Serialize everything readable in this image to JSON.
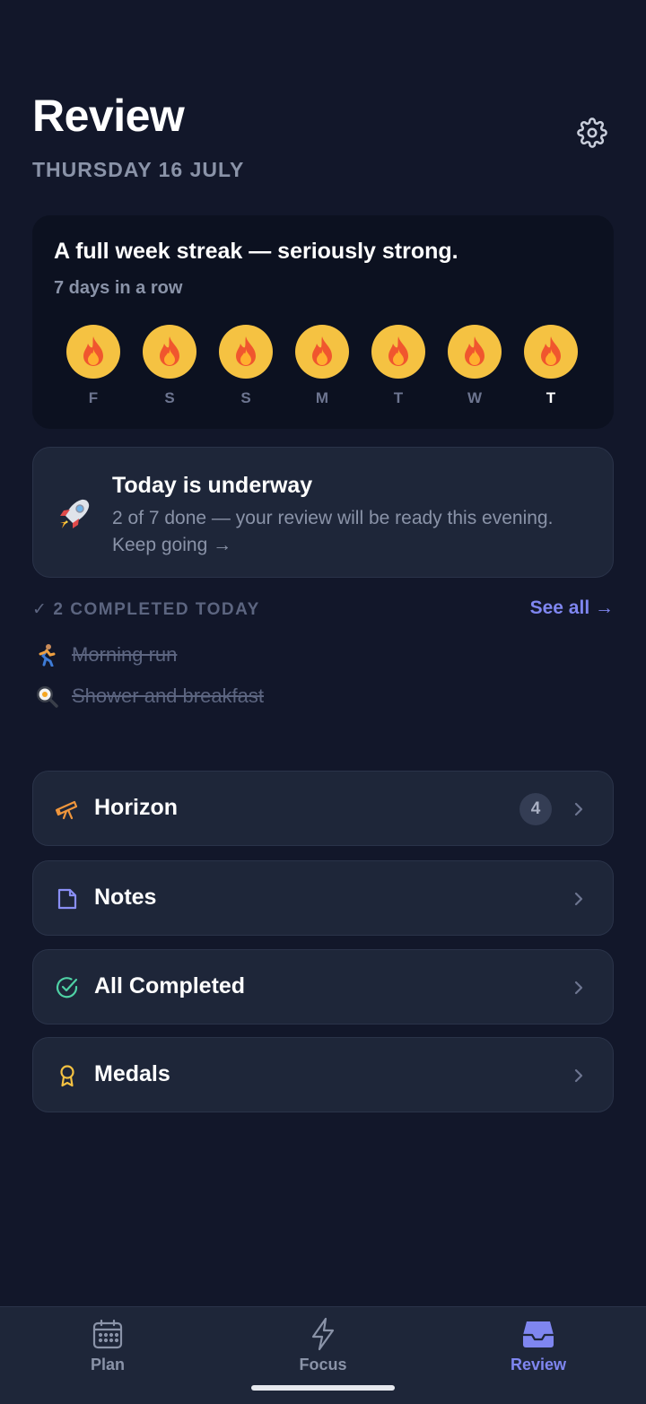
{
  "header": {
    "title": "Review",
    "date": "THURSDAY 16 JULY"
  },
  "streak": {
    "title": "A full week streak — seriously strong.",
    "subtitle": "7 days in a row",
    "days": [
      "F",
      "S",
      "S",
      "M",
      "T",
      "W",
      "T"
    ],
    "today_index": 6,
    "flame_color": "#f5c242"
  },
  "underway": {
    "title": "Today is underway",
    "body": "2 of 7 done — your review will be ready this evening. Keep going →"
  },
  "completed_today": {
    "label": "2 COMPLETED TODAY",
    "see_all": "See all →",
    "items": [
      {
        "icon": "runner-icon",
        "text": "Morning run"
      },
      {
        "icon": "fried-egg-icon",
        "text": "Shower and breakfast"
      }
    ]
  },
  "menu": [
    {
      "icon": "telescope-icon",
      "label": "Horizon",
      "badge": "4"
    },
    {
      "icon": "note-icon",
      "label": "Notes"
    },
    {
      "icon": "check-circle-icon",
      "label": "All Completed"
    },
    {
      "icon": "medal-icon",
      "label": "Medals"
    }
  ],
  "nav": [
    {
      "icon": "calendar-icon",
      "label": "Plan",
      "active": false
    },
    {
      "icon": "lightning-icon",
      "label": "Focus",
      "active": false
    },
    {
      "icon": "inbox-icon",
      "label": "Review",
      "active": true
    }
  ],
  "colors": {
    "background": "#12172a",
    "card": "#1e2639",
    "accent": "#7f86f0",
    "muted": "#8a93a8"
  }
}
